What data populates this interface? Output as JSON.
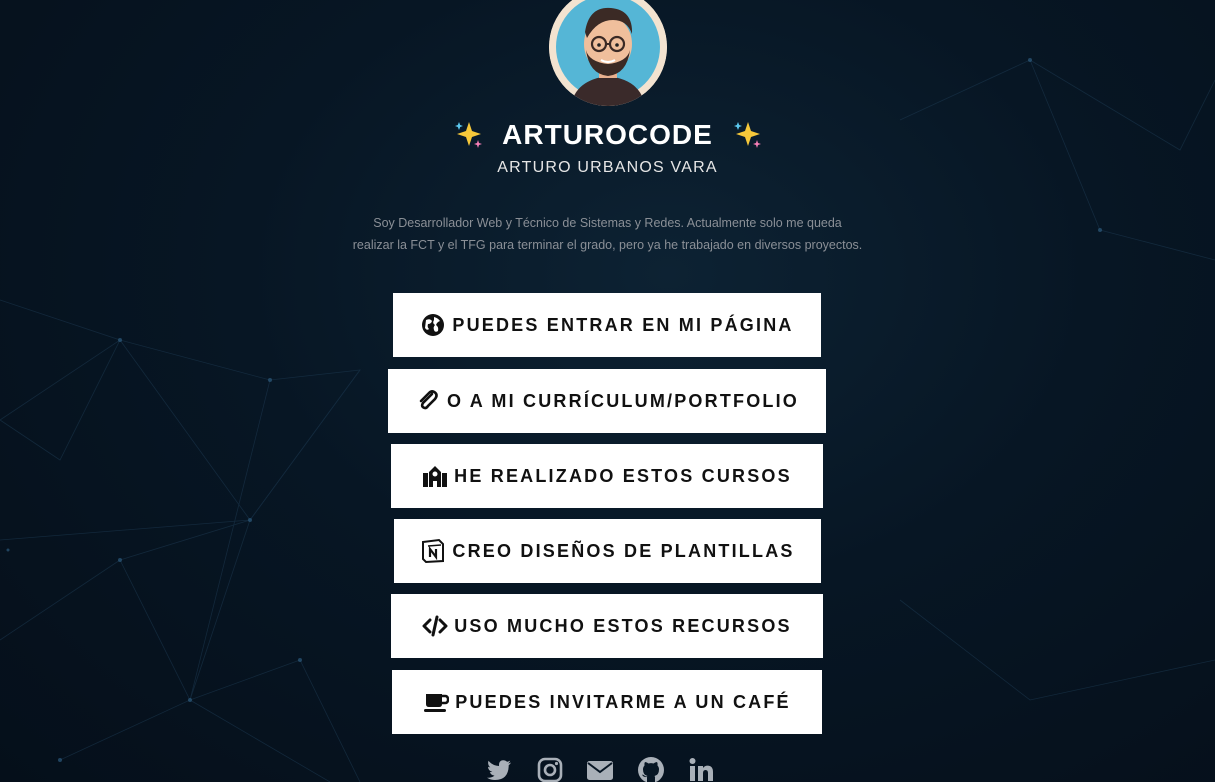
{
  "profile": {
    "name": "ARTUROCODE",
    "fullname": "ARTURO URBANOS VARA",
    "description_line1": "Soy Desarrollador Web y Técnico de Sistemas y Redes. Actualmente solo me queda",
    "description_line2": "realizar la FCT y el TFG para terminar el grado, pero ya he trabajado en diversos proyectos.",
    "title_icon": "sparkles-icon"
  },
  "links": [
    {
      "label": "PUEDES ENTRAR EN MI PÁGINA",
      "icon": "globe-icon"
    },
    {
      "label": "O A MI CURRÍCULUM/PORTFOLIO",
      "icon": "paperclip-icon"
    },
    {
      "label": "HE REALIZADO ESTOS CURSOS",
      "icon": "school-icon"
    },
    {
      "label": "CREO DISEÑOS DE PLANTILLAS",
      "icon": "notion-icon"
    },
    {
      "label": "USO MUCHO ESTOS RECURSOS",
      "icon": "code-icon"
    },
    {
      "label": "PUEDES INVITARME A UN CAFÉ",
      "icon": "coffee-icon"
    }
  ],
  "social": [
    "twitter-icon",
    "instagram-icon",
    "envelope-icon",
    "github-icon",
    "linkedin-icon"
  ],
  "colors": {
    "background": "#071624",
    "button": "#ffffff",
    "button_text": "#111111",
    "title": "#ffffff",
    "description": "#8a8f96",
    "social_icons": "#a9b0b8"
  }
}
